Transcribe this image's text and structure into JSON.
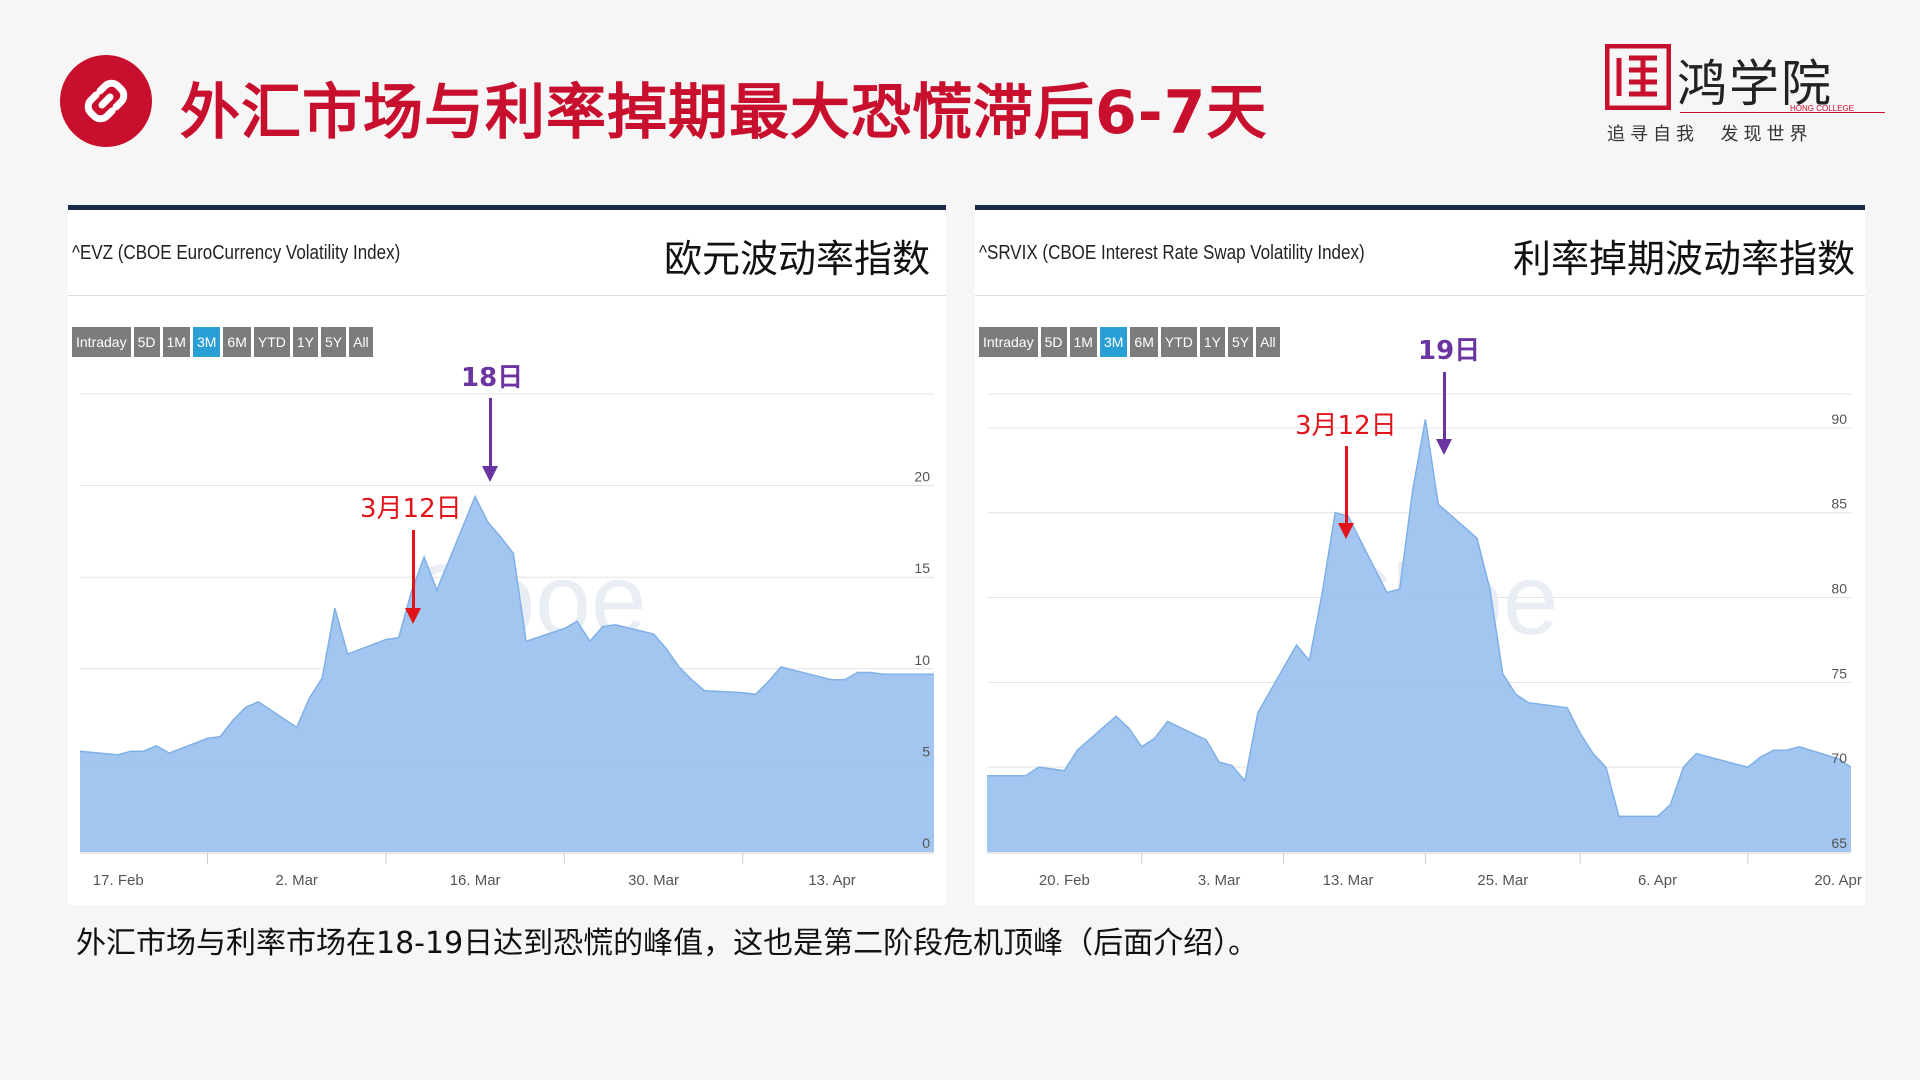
{
  "header": {
    "title": "外汇市场与利率掉期最大恐慌滞后6-7天",
    "icon": "link-icon",
    "accent_color": "#c8102e"
  },
  "logo": {
    "brand": "鸿学院",
    "english": "HONG COLLEGE",
    "slogan": "追寻自我  发现世界"
  },
  "panels": [
    {
      "symbol": "^EVZ (CBOE EuroCurrency Volatility Index)",
      "cn_title": "欧元波动率指数",
      "ranges": [
        "Intraday",
        "5D",
        "1M",
        "3M",
        "6M",
        "YTD",
        "1Y",
        "5Y",
        "All"
      ],
      "active_range": "3M",
      "watermark": "Cboe",
      "annotations": [
        {
          "label": "3月12日",
          "color": "red"
        },
        {
          "label": "18日",
          "color": "purple"
        }
      ]
    },
    {
      "symbol": "^SRVIX (CBOE Interest Rate Swap Volatility Index)",
      "cn_title": "利率掉期波动率指数",
      "ranges": [
        "Intraday",
        "5D",
        "1M",
        "3M",
        "6M",
        "YTD",
        "1Y",
        "5Y",
        "All"
      ],
      "active_range": "3M",
      "watermark": "Cboe",
      "annotations": [
        {
          "label": "3月12日",
          "color": "red"
        },
        {
          "label": "19日",
          "color": "purple"
        }
      ]
    }
  ],
  "caption": "外汇市场与利率市场在18-19日达到恐慌的峰值，这也是第二阶段危机顶峰（后面介绍）。",
  "chart_data": [
    {
      "type": "area",
      "title": "^EVZ (CBOE EuroCurrency Volatility Index)",
      "x_tick_labels": [
        "17. Feb",
        "2. Mar",
        "16. Mar",
        "30. Mar",
        "13. Apr"
      ],
      "x_tick_dates": [
        "2020-02-17",
        "2020-03-02",
        "2020-03-16",
        "2020-03-30",
        "2020-04-13"
      ],
      "y_ticks": [
        0,
        5,
        10,
        15,
        20
      ],
      "ylim": [
        0,
        25
      ],
      "y_axis_side": "right",
      "grid": true,
      "color": "#9dc3ee",
      "series": [
        {
          "x": [
            "2020-02-14",
            "2020-02-17",
            "2020-02-18",
            "2020-02-19",
            "2020-02-20",
            "2020-02-21",
            "2020-02-24",
            "2020-02-25",
            "2020-02-26",
            "2020-02-27",
            "2020-02-28",
            "2020-03-02",
            "2020-03-03",
            "2020-03-04",
            "2020-03-05",
            "2020-03-06",
            "2020-03-09",
            "2020-03-10",
            "2020-03-11",
            "2020-03-12",
            "2020-03-13",
            "2020-03-16",
            "2020-03-17",
            "2020-03-18",
            "2020-03-19",
            "2020-03-20",
            "2020-03-23",
            "2020-03-24",
            "2020-03-25",
            "2020-03-26",
            "2020-03-27",
            "2020-03-30",
            "2020-03-31",
            "2020-04-01",
            "2020-04-02",
            "2020-04-03",
            "2020-04-06",
            "2020-04-07",
            "2020-04-08",
            "2020-04-09",
            "2020-04-13",
            "2020-04-14",
            "2020-04-15",
            "2020-04-16",
            "2020-04-17",
            "2020-04-20",
            "2020-04-21"
          ],
          "y": [
            5.5,
            5.3,
            5.5,
            5.5,
            5.8,
            5.4,
            6.2,
            6.3,
            7.2,
            7.9,
            8.2,
            6.8,
            8.4,
            9.5,
            13.3,
            10.8,
            11.6,
            11.7,
            14.2,
            16.1,
            14.3,
            19.4,
            18.0,
            17.2,
            16.3,
            11.5,
            12.2,
            12.6,
            11.5,
            12.3,
            12.4,
            11.9,
            11.1,
            10.1,
            9.4,
            8.8,
            8.7,
            8.6,
            9.3,
            10.1,
            9.4,
            9.4,
            9.8,
            9.8,
            9.7,
            9.7,
            9.7
          ]
        }
      ]
    },
    {
      "type": "area",
      "title": "^SRVIX (CBOE Interest Rate Swap Volatility Index)",
      "x_tick_labels": [
        "20. Feb",
        "3. Mar",
        "13. Mar",
        "25. Mar",
        "6. Apr",
        "20. Apr"
      ],
      "x_tick_dates": [
        "2020-02-20",
        "2020-03-03",
        "2020-03-13",
        "2020-03-25",
        "2020-04-06",
        "2020-04-20"
      ],
      "y_ticks": [
        65,
        70,
        75,
        80,
        85,
        90
      ],
      "ylim": [
        65,
        92
      ],
      "y_axis_side": "right",
      "grid": true,
      "color": "#9dc3ee",
      "series": [
        {
          "x": [
            "2020-02-14",
            "2020-02-17",
            "2020-02-18",
            "2020-02-19",
            "2020-02-20",
            "2020-02-21",
            "2020-02-24",
            "2020-02-25",
            "2020-02-26",
            "2020-02-27",
            "2020-02-28",
            "2020-03-02",
            "2020-03-03",
            "2020-03-04",
            "2020-03-05",
            "2020-03-06",
            "2020-03-09",
            "2020-03-10",
            "2020-03-11",
            "2020-03-12",
            "2020-03-13",
            "2020-03-16",
            "2020-03-17",
            "2020-03-18",
            "2020-03-19",
            "2020-03-20",
            "2020-03-23",
            "2020-03-24",
            "2020-03-25",
            "2020-03-26",
            "2020-03-27",
            "2020-03-30",
            "2020-03-31",
            "2020-04-01",
            "2020-04-02",
            "2020-04-03",
            "2020-04-06",
            "2020-04-07",
            "2020-04-08",
            "2020-04-09",
            "2020-04-13",
            "2020-04-14",
            "2020-04-15",
            "2020-04-16",
            "2020-04-17",
            "2020-04-20",
            "2020-04-21"
          ],
          "y": [
            69.5,
            69.5,
            70.0,
            69.9,
            69.8,
            71.0,
            73.0,
            72.3,
            71.2,
            71.7,
            72.7,
            71.6,
            70.3,
            70.1,
            69.2,
            73.2,
            77.2,
            76.3,
            80.3,
            85.0,
            84.8,
            80.3,
            80.5,
            86.3,
            90.5,
            85.5,
            83.5,
            80.5,
            75.5,
            74.3,
            73.8,
            73.5,
            72.0,
            70.8,
            70.0,
            67.1,
            67.1,
            67.8,
            70.0,
            70.8,
            70.0,
            70.6,
            71.0,
            71.0,
            71.2,
            70.5,
            70.0
          ]
        }
      ]
    }
  ]
}
